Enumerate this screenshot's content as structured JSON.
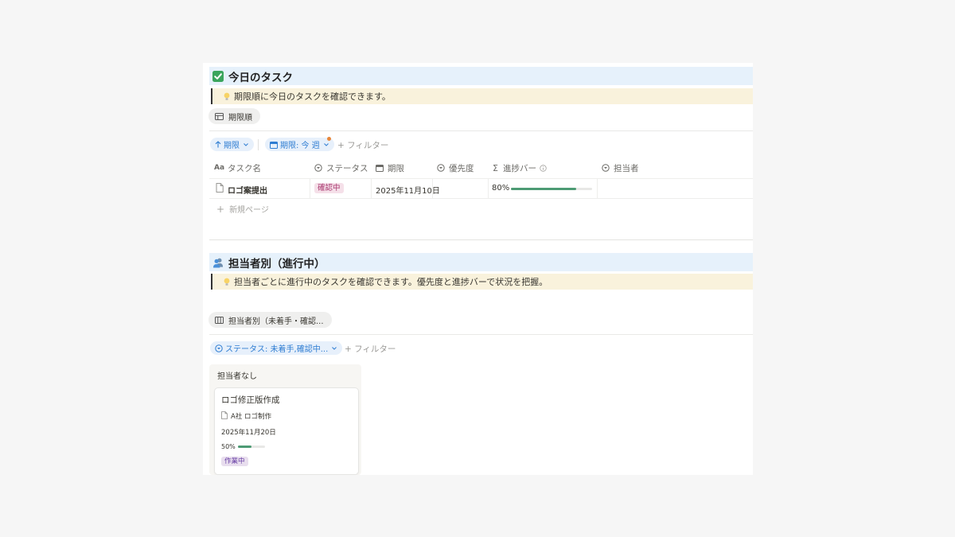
{
  "section1": {
    "title": "今日のタスク",
    "callout": "期限順に今日のタスクを確認できます。",
    "view_tab": "期限順",
    "sort_chip": "期限",
    "date_filter_chip": "期限: 今 週",
    "add_filter": "+ フィルター",
    "columns": [
      "タスク名",
      "ステータス",
      "期限",
      "優先度",
      "進捗バー",
      "担当者"
    ],
    "rows": [
      {
        "name": "ロゴ案提出",
        "status": "確認中",
        "due": "2025年11月10日",
        "priority": "",
        "progress_label": "80%",
        "progress": 0.8,
        "assignee": ""
      }
    ],
    "new_page": "新規ページ"
  },
  "section2": {
    "title": "担当者別（進行中）",
    "callout": "担当者ごとに進行中のタスクを確認できます。優先度と進捗バーで状況を把握。",
    "view_tab": "担当者別（未着手・確認...",
    "status_filter_chip": "ステータス: 未着手,確認中...",
    "add_filter": "+ フィルター",
    "group_label": "担当者なし",
    "card": {
      "title": "ロゴ修正版作成",
      "project": "A社 ロゴ制作",
      "due": "2025年11月20日",
      "progress_label": "50%",
      "progress": 0.5,
      "status": "作業中"
    }
  },
  "colors": {
    "header_bg": "#e6f1fb",
    "callout_bg": "#f9f2dc",
    "chip_bg": "#e7f0fb",
    "chip_text": "#2f7dd2",
    "status_confirm_bg": "#f5e0e9",
    "status_confirm_text": "#a9386f",
    "status_working_bg": "#e8deee",
    "status_working_text": "#6940a5",
    "progress": "#4d9b74",
    "check_green": "#3aa55d"
  },
  "icons": {
    "section1": "check-box-icon",
    "section2": "people-icon",
    "callout": "lightbulb-icon",
    "view1": "table-icon",
    "view2": "board-icon"
  }
}
